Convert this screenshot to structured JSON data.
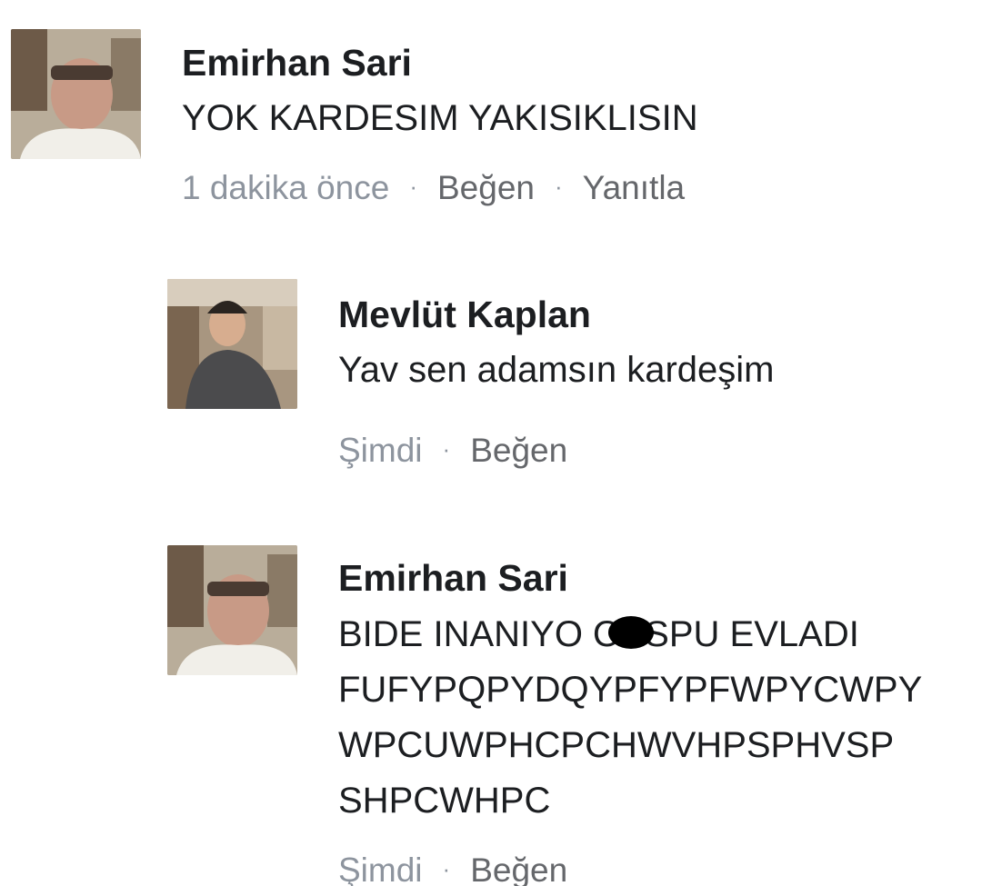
{
  "comments": [
    {
      "author": "Emirhan Sari",
      "lines": [
        "YOK KARDESIM YAKISIKLISIN"
      ],
      "time": "1 dakika önce",
      "like_label": "Beğen",
      "reply_label": "Yanıtla"
    },
    {
      "author": "Mevlüt Kaplan",
      "lines": [
        "Yav sen adamsın kardeşim"
      ],
      "time": "Şimdi",
      "like_label": "Beğen"
    },
    {
      "author": "Emirhan Sari",
      "line1_before_redaction": "BIDE INANIYO O",
      "line1_after_redaction": "SPU EVLADI",
      "lines": [
        "FUFYPQPYDQYPFYPFWPYCWPY",
        "WPCUWPHCPCHWVHPSPHVSP",
        "SHPCWHPC"
      ],
      "time": "Şimdi",
      "like_label": "Beğen"
    }
  ],
  "separator": "·",
  "colors": {
    "text": "#1c1e21",
    "meta": "#8d949e",
    "background": "#ffffff"
  }
}
